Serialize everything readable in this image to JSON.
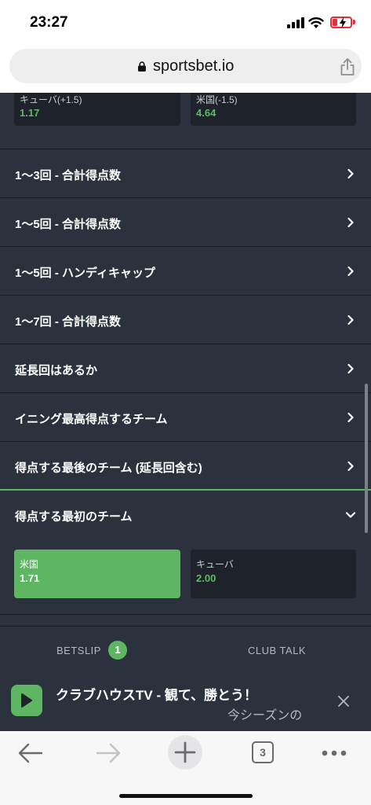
{
  "status_bar": {
    "time": "23:27"
  },
  "browser": {
    "url": "sportsbet.io",
    "tab_count": "3"
  },
  "top_odds": [
    {
      "label": "キューバ(+1.5)",
      "value": "1.17"
    },
    {
      "label": "米国(-1.5)",
      "value": "4.64"
    }
  ],
  "markets": [
    {
      "title": "1〜3回 - 合計得点数"
    },
    {
      "title": "1〜5回 - 合計得点数"
    },
    {
      "title": "1〜5回 - ハンディキャップ"
    },
    {
      "title": "1〜7回 - 合計得点数"
    },
    {
      "title": "延長回はあるか"
    },
    {
      "title": "イニング最高得点するチーム"
    },
    {
      "title": "得点する最後のチーム (延長回含む)"
    }
  ],
  "open_market": {
    "title": "得点する最初のチーム",
    "options": [
      {
        "label": "米国",
        "value": "1.71",
        "selected": true
      },
      {
        "label": "キューバ",
        "value": "2.00",
        "selected": false
      }
    ]
  },
  "betslip": {
    "label": "BETSLIP",
    "count": "1",
    "club_talk": "CLUB TALK"
  },
  "promo": {
    "title": "クラブハウスTV - 観て、勝とう！",
    "subtitle": "今シーズンの"
  },
  "colors": {
    "accent": "#5eb662",
    "background": "#2b313d",
    "card": "#1d222b"
  }
}
